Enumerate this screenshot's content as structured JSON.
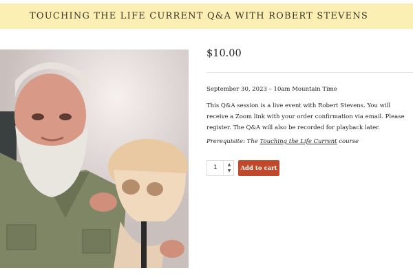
{
  "banner": {
    "title": "TOUCHING THE LIFE CURRENT Q&A WITH ROBERT STEVENS"
  },
  "product": {
    "price": "$10.00",
    "date_line": "September 30, 2023 – 10am Mountain Time",
    "description": "This Q&A session is a live event with Robert Stevens. You will receive a Zoom link with your order confirmation via email. Please register. The Q&A will also be recorded for playback later.",
    "prereq_label": "Prerequisite: The ",
    "prereq_link": "Touching the Life Current",
    "prereq_suffix": " course",
    "quantity": "1",
    "add_to_cart_label": "Add to cart",
    "image_alt": "Robert Stevens holding a skull model"
  },
  "colors": {
    "banner_bg": "#fcefb4",
    "button_bg": "#c0492b"
  }
}
